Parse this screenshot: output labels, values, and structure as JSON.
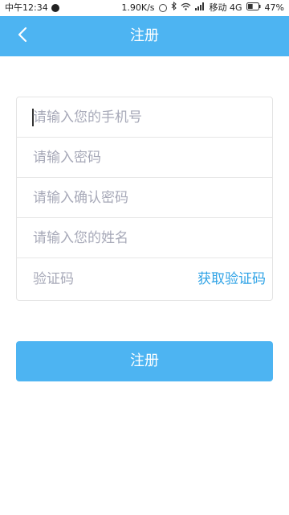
{
  "status_bar": {
    "carrier_time": "中午12:34",
    "speed": "1.90K/s",
    "network_carrier": "移动 4G",
    "battery_percent_text": "47%",
    "battery_level": 0.47
  },
  "app_bar": {
    "title": "注册",
    "back_icon": "chevron-left-icon",
    "background_color": "#4db4f2"
  },
  "form": {
    "fields": [
      {
        "name": "phone",
        "placeholder": "请输入您的手机号",
        "value": ""
      },
      {
        "name": "password",
        "placeholder": "请输入密码",
        "value": ""
      },
      {
        "name": "confirm_password",
        "placeholder": "请输入确认密码",
        "value": ""
      },
      {
        "name": "full_name",
        "placeholder": "请输入您的姓名",
        "value": ""
      },
      {
        "name": "verification_code",
        "placeholder": "验证码",
        "value": ""
      }
    ],
    "get_code_label": "获取验证码",
    "link_color": "#2fa3e6"
  },
  "submit": {
    "label": "注册",
    "color": "#4db4f2"
  }
}
